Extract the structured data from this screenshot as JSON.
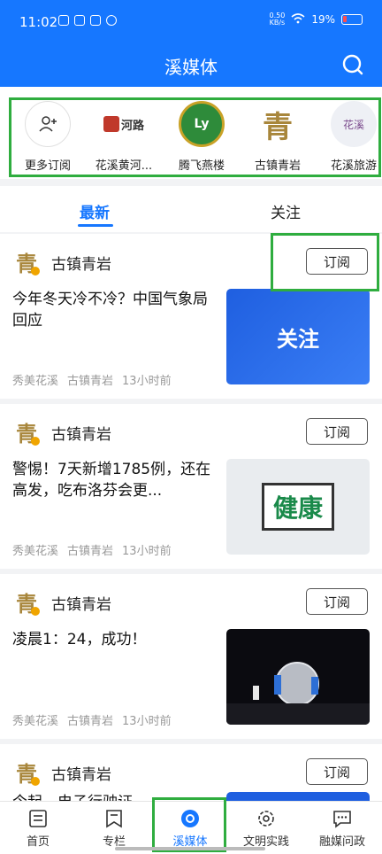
{
  "status": {
    "time": "11:02",
    "speed_top": "0.50",
    "speed_bottom": "KB/s",
    "battery": "19%"
  },
  "header": {
    "title": "溪媒体"
  },
  "subscriptions": [
    {
      "label": "更多订阅"
    },
    {
      "label": "花溪黄河...",
      "logo_text": "河路"
    },
    {
      "label": "腾飞燕楼",
      "logo_text": "Ly"
    },
    {
      "label": "古镇青岩",
      "logo_text": "青"
    },
    {
      "label": "花溪旅游",
      "logo_text": "花溪"
    }
  ],
  "tabs": [
    {
      "label": "最新"
    },
    {
      "label": "关注"
    }
  ],
  "feed": [
    {
      "author": "古镇青岩",
      "subscribe": "订阅",
      "headline": "今年冬天冷不冷？中国气象局回应",
      "meta": [
        "秀美花溪",
        "古镇青岩",
        "13小时前"
      ],
      "thumb_text": "关注"
    },
    {
      "author": "古镇青岩",
      "subscribe": "订阅",
      "headline": "警惕！7天新增1785例，还在高发，吃布洛芬会更...",
      "meta": [
        "秀美花溪",
        "古镇青岩",
        "13小时前"
      ],
      "thumb_text": "健康"
    },
    {
      "author": "古镇青岩",
      "subscribe": "订阅",
      "headline": "凌晨1：24，成功！",
      "meta": [
        "秀美花溪",
        "古镇青岩",
        "13小时前"
      ]
    },
    {
      "author": "古镇青岩",
      "subscribe": "订阅",
      "headline": "今起，电子行驶证...",
      "meta": []
    }
  ],
  "bottom_nav": [
    {
      "label": "首页",
      "icon": "home-icon"
    },
    {
      "label": "专栏",
      "icon": "column-icon"
    },
    {
      "label": "溪媒体",
      "icon": "media-icon"
    },
    {
      "label": "文明实践",
      "icon": "gear-icon"
    },
    {
      "label": "融媒问政",
      "icon": "chat-icon"
    }
  ],
  "colors": {
    "brand": "#1677ff",
    "highlight": "#2fad3f"
  }
}
